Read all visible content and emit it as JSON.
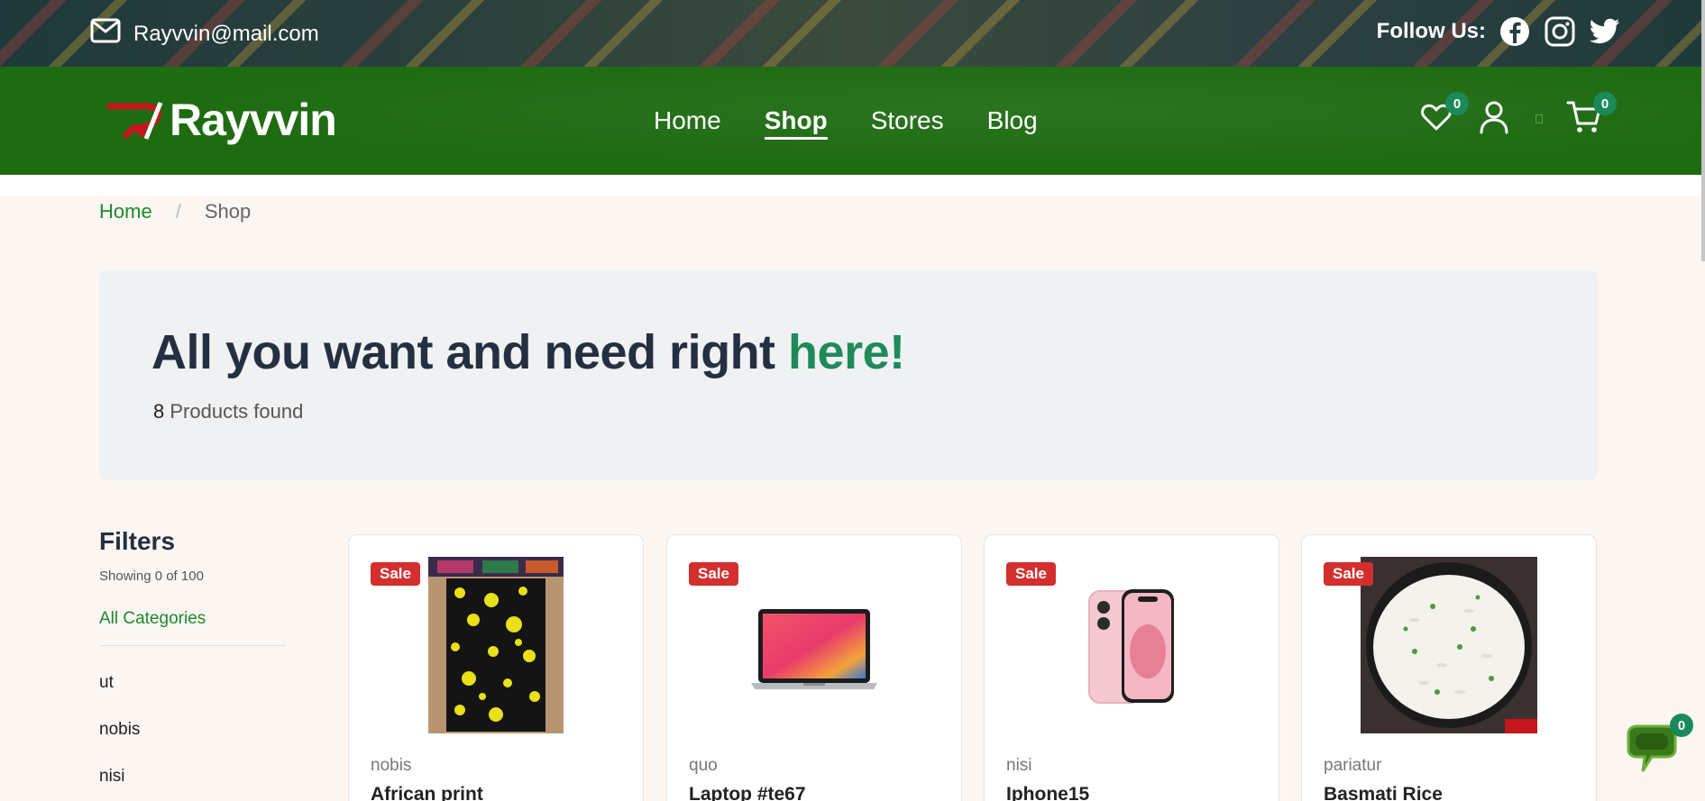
{
  "topbar": {
    "email": "Rayvvin@mail.com",
    "follow_label": "Follow Us:",
    "social_icons": [
      "facebook-icon",
      "instagram-icon",
      "twitter-icon"
    ]
  },
  "navbar": {
    "logo_text": "Rayvvin",
    "links": [
      {
        "label": "Home",
        "active": false
      },
      {
        "label": "Shop",
        "active": true
      },
      {
        "label": "Stores",
        "active": false
      },
      {
        "label": "Blog",
        "active": false
      }
    ],
    "wishlist_count": "0",
    "cart_count": "0"
  },
  "breadcrumb": {
    "home": "Home",
    "separator": "/",
    "current": "Shop"
  },
  "hero": {
    "title_main": "All you want and need right ",
    "title_accent": "here!",
    "count_number": "8",
    "count_label": " Products found"
  },
  "filters": {
    "title": "Filters",
    "showing": "Showing 0 of 100",
    "all_categories": "All Categories",
    "categories": [
      "ut",
      "nobis",
      "nisi"
    ]
  },
  "products": [
    {
      "badge": "Sale",
      "vendor": "nobis",
      "name": "African print"
    },
    {
      "badge": "Sale",
      "vendor": "quo",
      "name": "Laptop #te67"
    },
    {
      "badge": "Sale",
      "vendor": "nisi",
      "name": "Iphone15"
    },
    {
      "badge": "Sale",
      "vendor": "pariatur",
      "name": "Basmati Rice"
    }
  ],
  "chat": {
    "count": "0"
  },
  "colors": {
    "brand_green": "#1e6b12",
    "accent_green": "#1f8a5a",
    "sale_red": "#d32f2f",
    "badge_green": "#1b8a5a"
  }
}
